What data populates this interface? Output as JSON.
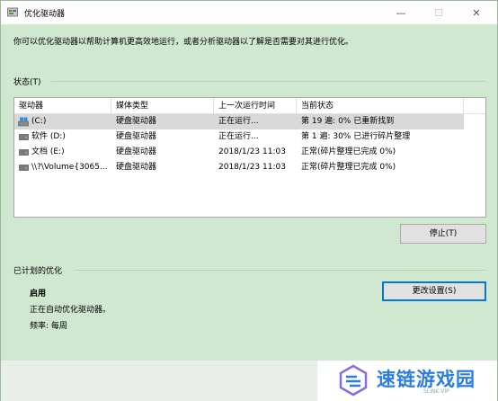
{
  "window": {
    "title": "优化驱动器",
    "controls": {
      "minimize": "—",
      "maximize": "☐",
      "close": "✕"
    }
  },
  "description": "你可以优化驱动器以帮助计算机更高效地运行，或者分析驱动器以了解是否需要对其进行优化。",
  "status_section": {
    "label": "状态(T)",
    "columns": [
      "驱动器",
      "媒体类型",
      "上一次运行时间",
      "当前状态"
    ],
    "rows": [
      {
        "drive": "(C:)",
        "media": "硬盘驱动器",
        "last_run": "正在运行...",
        "status": "第 19 遍: 0% 已重新找到",
        "icon": "system-drive-icon",
        "selected": true
      },
      {
        "drive": "软件 (D:)",
        "media": "硬盘驱动器",
        "last_run": "正在运行...",
        "status": "第 1 遍: 30% 已进行碎片整理",
        "icon": "hard-drive-icon",
        "selected": false
      },
      {
        "drive": "文档 (E:)",
        "media": "硬盘驱动器",
        "last_run": "2018/1/23 11:03",
        "status": "正常(碎片整理已完成 0%)",
        "icon": "hard-drive-icon",
        "selected": false
      },
      {
        "drive": "\\\\?\\Volume{3065...",
        "media": "硬盘驱动器",
        "last_run": "2018/1/23 11:03",
        "status": "正常(碎片整理已完成 0%)",
        "icon": "hard-drive-icon",
        "selected": false
      }
    ],
    "stop_button": "停止(T)"
  },
  "scheduled_section": {
    "label": "已计划的优化",
    "state": "启用",
    "detail": "正在自动优化驱动器。",
    "frequency": "频率: 每周",
    "change_button": "更改设置(S)"
  },
  "watermark": {
    "text": "速链游戏园",
    "sub": "SLINK.VIP"
  },
  "colors": {
    "background": "#cfe8cf",
    "selected_row": "#d9d9d9",
    "accent": "#0078d7",
    "watermark": "#2b7de1"
  }
}
